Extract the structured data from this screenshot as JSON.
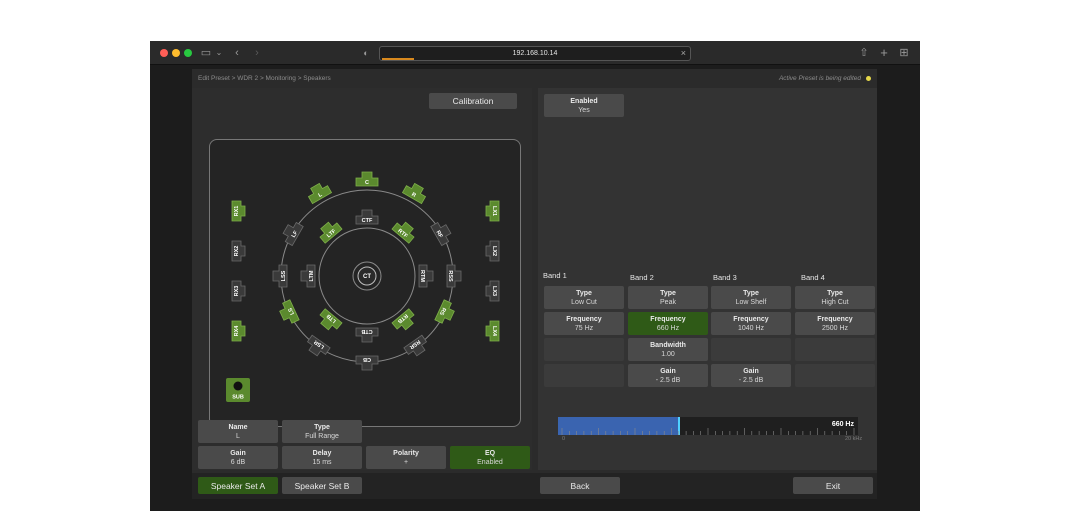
{
  "browser": {
    "url": "192.168.10.14",
    "close_glyph": "×"
  },
  "breadcrumb": "Edit Preset > WDR 2 > Monitoring > Speakers",
  "status_text": "Active Preset is being edited",
  "calibration_label": "Calibration",
  "speakers": {
    "center": "CT",
    "active_color": "#5b8a2e",
    "inactive_color": "#3a3a3a",
    "outer": [
      {
        "label": "C",
        "active": true
      },
      {
        "label": "L",
        "active": true
      },
      {
        "label": "R",
        "active": true
      },
      {
        "label": "LF",
        "active": false
      },
      {
        "label": "RF",
        "active": false
      },
      {
        "label": "LSS",
        "active": false
      },
      {
        "label": "RSS",
        "active": false
      },
      {
        "label": "LS",
        "active": true
      },
      {
        "label": "RS",
        "active": true
      },
      {
        "label": "LSR",
        "active": false
      },
      {
        "label": "RSR",
        "active": false
      },
      {
        "label": "CB",
        "active": false
      }
    ],
    "inner": [
      {
        "label": "CTF",
        "active": false
      },
      {
        "label": "LTF",
        "active": true
      },
      {
        "label": "RTF",
        "active": true
      },
      {
        "label": "LTM",
        "active": false
      },
      {
        "label": "RTM",
        "active": false
      },
      {
        "label": "LTB",
        "active": true
      },
      {
        "label": "RTB",
        "active": true
      },
      {
        "label": "CTB",
        "active": false
      }
    ],
    "left_side": [
      {
        "label": "RX1",
        "active": true
      },
      {
        "label": "RX2",
        "active": false
      },
      {
        "label": "RX3",
        "active": false
      },
      {
        "label": "RX4",
        "active": true
      }
    ],
    "right_side": [
      {
        "label": "LX1",
        "active": true
      },
      {
        "label": "LX2",
        "active": false
      },
      {
        "label": "LX3",
        "active": false
      },
      {
        "label": "LX4",
        "active": true
      }
    ],
    "sub_label": "SUB"
  },
  "props": {
    "name_title": "Name",
    "name_value": "L",
    "type_title": "Type",
    "type_value": "Full Range",
    "gain_title": "Gain",
    "gain_value": "6 dB",
    "delay_title": "Delay",
    "delay_value": "15 ms",
    "polarity_title": "Polarity",
    "polarity_value": "+",
    "eq_title": "EQ",
    "eq_value": "Enabled"
  },
  "eq": {
    "enabled_title": "Enabled",
    "enabled_value": "Yes",
    "bands": [
      {
        "label": "Band 1",
        "type_title": "Type",
        "type": "Low Cut",
        "freq_title": "Frequency",
        "freq": "75 Hz"
      },
      {
        "label": "Band 2",
        "type_title": "Type",
        "type": "Peak",
        "freq_title": "Frequency",
        "freq": "660 Hz",
        "bw_title": "Bandwidth",
        "bw": "1.00",
        "gain_title": "Gain",
        "gain": "- 2.5 dB"
      },
      {
        "label": "Band 3",
        "type_title": "Type",
        "type": "Low Shelf",
        "freq_title": "Frequency",
        "freq": "1040 Hz",
        "gain_title": "Gain",
        "gain": "- 2.5 dB"
      },
      {
        "label": "Band 4",
        "type_title": "Type",
        "type": "High Cut",
        "freq_title": "Frequency",
        "freq": "2500 Hz"
      }
    ],
    "slider": {
      "value_label": "660 Hz",
      "fill_fraction": 0.4,
      "min_label": "0",
      "max_label": "20 kHz"
    }
  },
  "bottom": {
    "set_a": "Speaker Set A",
    "set_b": "Speaker Set B",
    "back": "Back",
    "exit": "Exit"
  }
}
